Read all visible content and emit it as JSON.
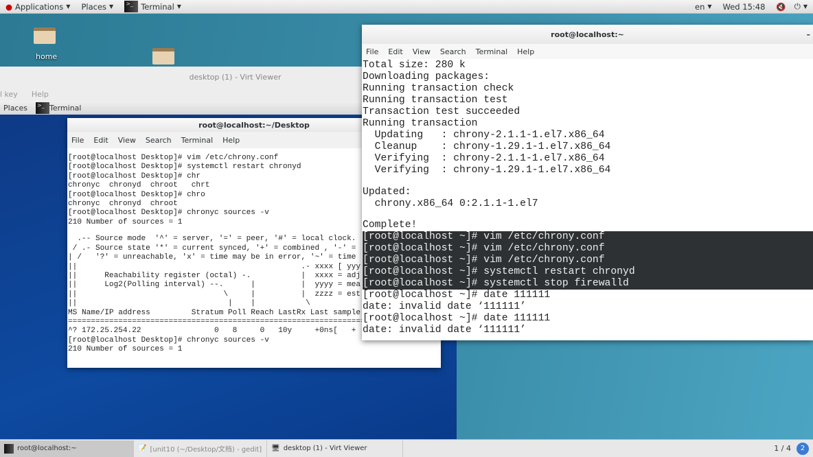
{
  "top_bar": {
    "applications": "Applications",
    "places": "Places",
    "terminal": "Terminal",
    "lang": "en",
    "clock": "Wed 15:48",
    "icons": [
      "redhat-icon",
      "volume-muted-icon",
      "power-icon"
    ]
  },
  "desktop": {
    "home_label": "home"
  },
  "virt_viewer": {
    "title": "desktop (1) - Virt Viewer",
    "menu": [
      "l key",
      "Help"
    ],
    "vm_top": {
      "places": "Places",
      "terminal": "Terminal"
    }
  },
  "left_terminal": {
    "title": "root@localhost:~/Desktop",
    "menu": [
      "File",
      "Edit",
      "View",
      "Search",
      "Terminal",
      "Help"
    ],
    "lines": [
      "[root@localhost Desktop]# vim /etc/chrony.conf",
      "[root@localhost Desktop]# systemctl restart chronyd",
      "[root@localhost Desktop]# chr",
      "chronyc  chronyd  chroot   chrt",
      "[root@localhost Desktop]# chro",
      "chronyc  chronyd  chroot",
      "[root@localhost Desktop]# chronyc sources -v",
      "210 Number of sources = 1",
      "",
      "  .-- Source mode  '^' = server, '=' = peer, '#' = local clock.",
      " / .- Source state '*' = current synced, '+' = combined , '-' =",
      "| /   '?' = unreachable, 'x' = time may be in error, '~' = time",
      "||                                                 .- xxxx [ yyy",
      "||      Reachability register (octal) -.           |  xxxx = adj",
      "||      Log2(Polling interval) --.      |          |  yyyy = mea",
      "||                                \\     |          |  zzzz = est",
      "||                                 |    |           \\",
      "MS Name/IP address         Stratum Poll Reach LastRx Last sample",
      "===============================================================================",
      "^? 172.25.254.22                0   8     0   10y     +0ns[   +",
      "[root@localhost Desktop]# chronyc sources -v",
      "210 Number of sources = 1"
    ]
  },
  "right_terminal": {
    "title": "root@localhost:~",
    "menu": [
      "File",
      "Edit",
      "View",
      "Search",
      "Terminal",
      "Help"
    ],
    "lines": [
      "Total size: 280 k",
      "Downloading packages:",
      "Running transaction check",
      "Running transaction test",
      "Transaction test succeeded",
      "Running transaction",
      "  Updating   : chrony-2.1.1-1.el7.x86_64",
      "  Cleanup    : chrony-1.29.1-1.el7.x86_64",
      "  Verifying  : chrony-2.1.1-1.el7.x86_64",
      "  Verifying  : chrony-1.29.1-1.el7.x86_64",
      "",
      "Updated:",
      "  chrony.x86_64 0:2.1.1-1.el7",
      "",
      "Complete!",
      "[root@localhost ~]# vim /etc/chrony.conf",
      "[root@localhost ~]# vim /etc/chrony.conf",
      "[root@localhost ~]# vim /etc/chrony.conf",
      "[root@localhost ~]# systemctl restart chronyd",
      "[root@localhost ~]# systemctl stop firewalld",
      "[root@localhost ~]# date 111111",
      "date: invalid date ‘111111’",
      "[root@localhost ~]# date 111111",
      "date: invalid date ‘111111’"
    ],
    "highlighted_lines": [
      15,
      16,
      17,
      18,
      19
    ]
  },
  "taskbar": {
    "tasks": [
      "root@localhost:~",
      "[unit10 (~/Desktop/文档) - gedit]",
      "desktop (1) - Virt Viewer"
    ],
    "workspace": "1 / 4",
    "workspace_badge": "2"
  },
  "colors": {
    "highlight": "#2d3133",
    "vm_desktop": "#0d3b8e",
    "host_desktop": "#2f7f99"
  }
}
